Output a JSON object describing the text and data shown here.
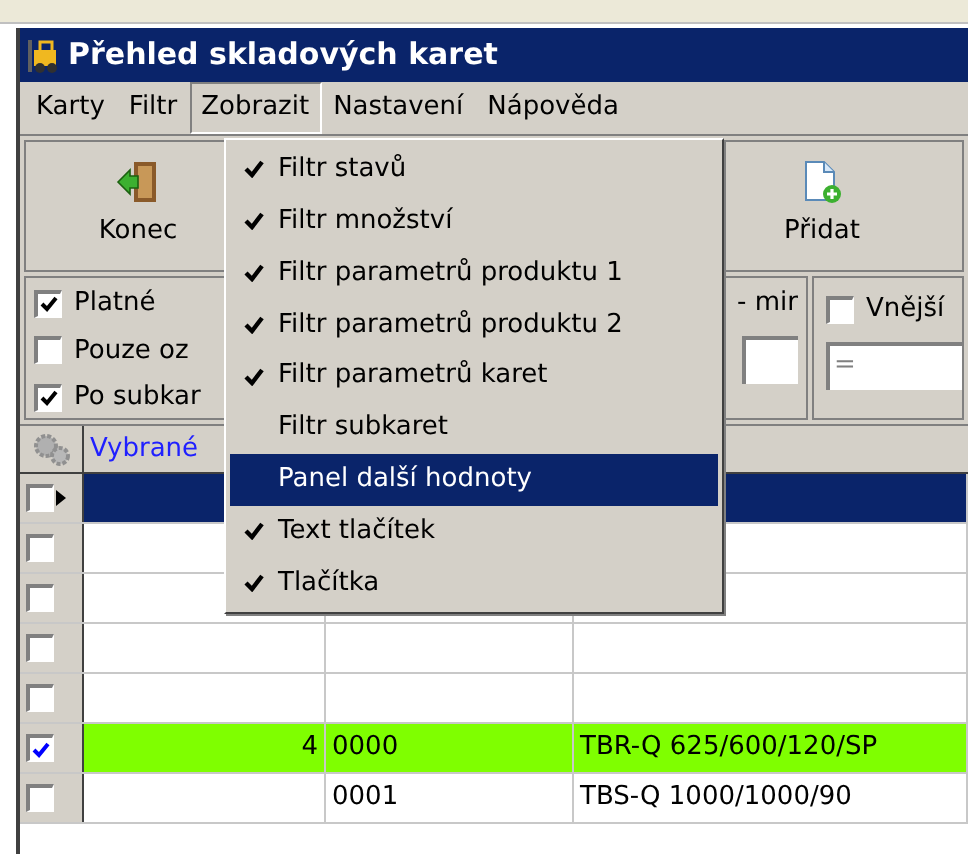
{
  "window": {
    "title": "Přehled skladových karet"
  },
  "menubar": [
    {
      "label": "Karty",
      "selected": false
    },
    {
      "label": "Filtr",
      "selected": false
    },
    {
      "label": "Zobrazit",
      "selected": true
    },
    {
      "label": "Nastavení",
      "selected": false
    },
    {
      "label": "Nápověda",
      "selected": false
    }
  ],
  "toolbar": [
    {
      "label": "Konec",
      "kind": "exit"
    },
    {
      "label": "Přidat",
      "kind": "add"
    }
  ],
  "filters": {
    "checkboxes": [
      {
        "label": "Platné",
        "checked": true
      },
      {
        "label": "Pouze oz",
        "checked": false
      },
      {
        "label": "Po subkar",
        "checked": true
      }
    ],
    "range_label": "- mir",
    "outer": {
      "label": "Vnější",
      "checked": false,
      "value": "="
    }
  },
  "dropdown": [
    {
      "label": "Filtr stavů",
      "checked": true,
      "selected": false
    },
    {
      "label": "Filtr množství",
      "checked": true,
      "selected": false
    },
    {
      "label": "Filtr parametrů produktu 1",
      "checked": true,
      "selected": false
    },
    {
      "label": "Filtr parametrů produktu 2",
      "checked": true,
      "selected": false
    },
    {
      "label": "Filtr parametrů karet",
      "checked": true,
      "selected": false
    },
    {
      "label": "Filtr subkaret",
      "checked": false,
      "selected": false
    },
    {
      "label": "Panel další hodnoty",
      "checked": false,
      "selected": true
    },
    {
      "label": "Text tlačítek",
      "checked": true,
      "selected": false
    },
    {
      "label": "Tlačítka",
      "checked": true,
      "selected": false
    }
  ],
  "table": {
    "columns": [
      "Vybrané"
    ],
    "rows": [
      {
        "checked": false,
        "selected": true,
        "highlighted": false,
        "cells": []
      },
      {
        "checked": false,
        "selected": false,
        "highlighted": false,
        "cells": []
      },
      {
        "checked": false,
        "selected": false,
        "highlighted": false,
        "cells": []
      },
      {
        "checked": false,
        "selected": false,
        "highlighted": false,
        "cells": []
      },
      {
        "checked": false,
        "selected": false,
        "highlighted": false,
        "cells": []
      },
      {
        "checked": true,
        "selected": false,
        "highlighted": true,
        "cells": [
          "4",
          "0000",
          "TBR-Q 625/600/120/SP"
        ]
      },
      {
        "checked": false,
        "selected": false,
        "highlighted": false,
        "cells": [
          "",
          "0001",
          "TBS-Q 1000/1000/90"
        ]
      }
    ]
  }
}
